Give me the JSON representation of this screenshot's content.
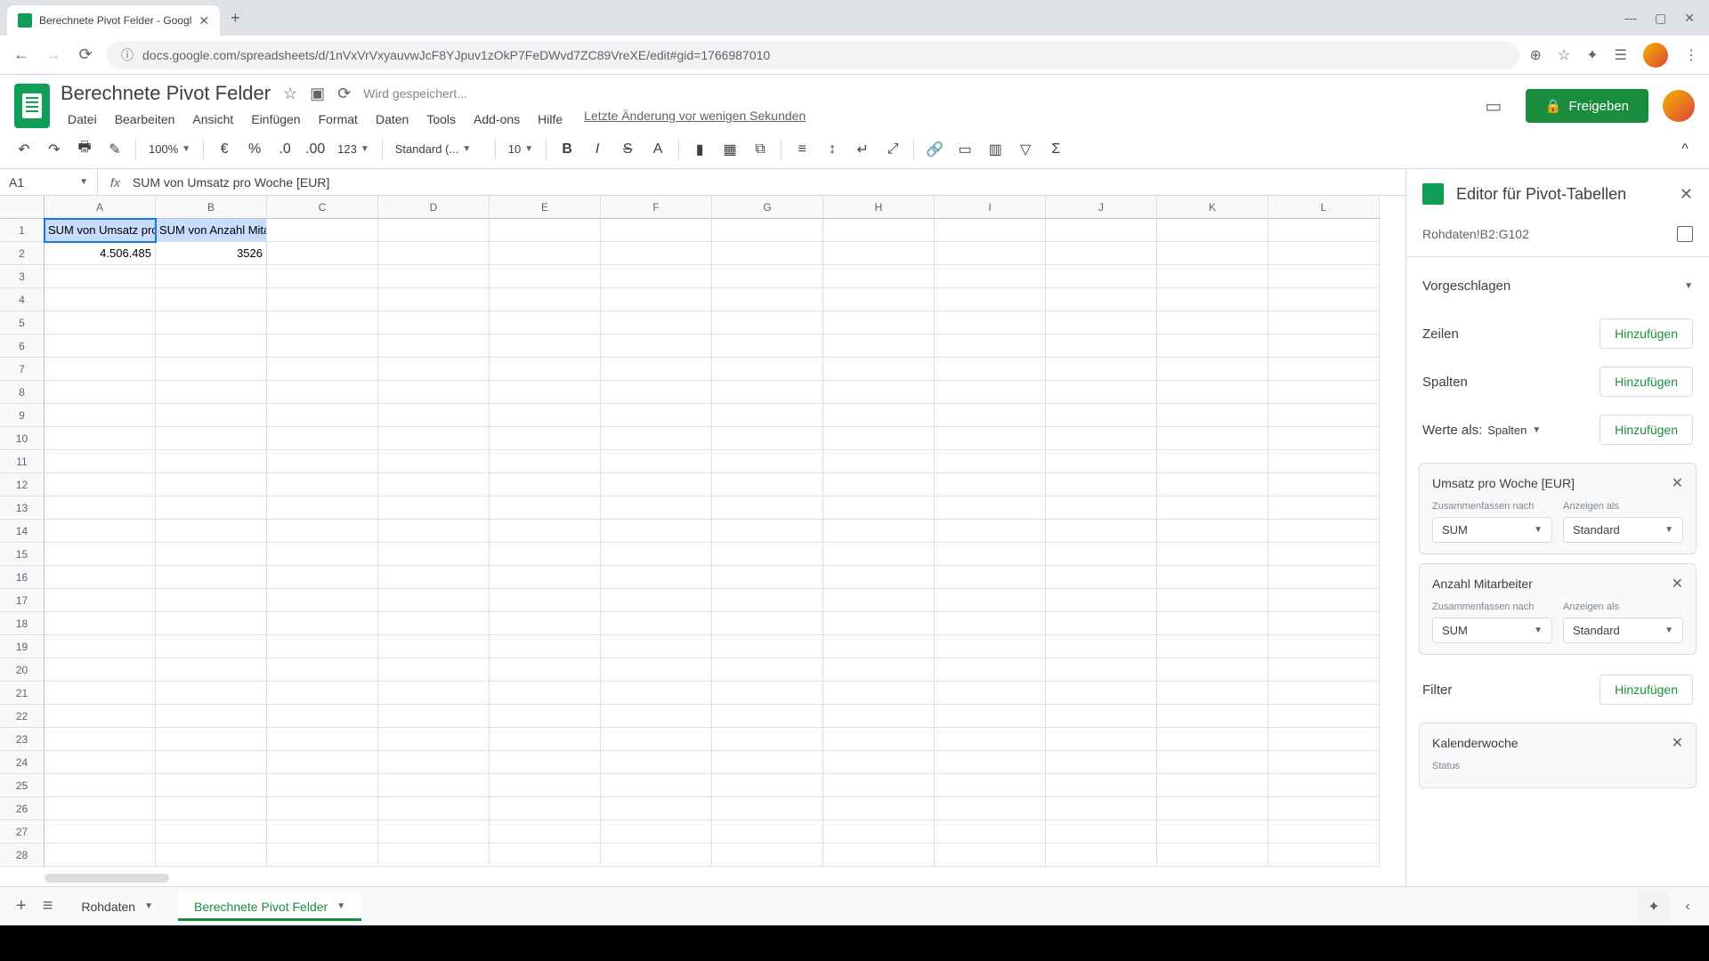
{
  "browser": {
    "tab_title": "Berechnete Pivot Felder - Googl",
    "url": "docs.google.com/spreadsheets/d/1nVxVrVxyauvwJcF8YJpuv1zOkP7FeDWvd7ZC89VreXE/edit#gid=1766987010"
  },
  "doc": {
    "title": "Berechnete Pivot Felder",
    "save_status": "Wird gespeichert...",
    "last_edit": "Letzte Änderung vor wenigen Sekunden"
  },
  "menu": {
    "file": "Datei",
    "edit": "Bearbeiten",
    "view": "Ansicht",
    "insert": "Einfügen",
    "format": "Format",
    "data": "Daten",
    "tools": "Tools",
    "addons": "Add-ons",
    "help": "Hilfe"
  },
  "share_btn": "Freigeben",
  "toolbar": {
    "zoom": "100%",
    "currency": "€",
    "format_123": "123",
    "font": "Standard (...",
    "font_size": "10"
  },
  "namebox": "A1",
  "formula": "SUM von Umsatz pro Woche [EUR]",
  "columns": [
    "A",
    "B",
    "C",
    "D",
    "E",
    "F",
    "G",
    "H",
    "I",
    "J",
    "K",
    "L"
  ],
  "cells": {
    "A1": "SUM von Umsatz pro Woche [EUR]",
    "B1": "SUM von Anzahl Mitarbeiter",
    "A2": "4.506.485",
    "B2": "3526"
  },
  "pivot": {
    "title": "Editor für Pivot-Tabellen",
    "range": "Rohdaten!B2:G102",
    "suggested": "Vorgeschlagen",
    "rows": "Zeilen",
    "cols": "Spalten",
    "values_as": "Werte als:",
    "values_mode": "Spalten",
    "add": "Hinzufügen",
    "summarize_by": "Zusammenfassen nach",
    "show_as": "Anzeigen als",
    "sum": "SUM",
    "standard": "Standard",
    "filter": "Filter",
    "status": "Status",
    "cards": {
      "c1": "Umsatz pro Woche [EUR]",
      "c2": "Anzahl Mitarbeiter",
      "c3": "Kalenderwoche"
    }
  },
  "tabs": {
    "rohdaten": "Rohdaten",
    "pivot": "Berechnete Pivot Felder"
  }
}
